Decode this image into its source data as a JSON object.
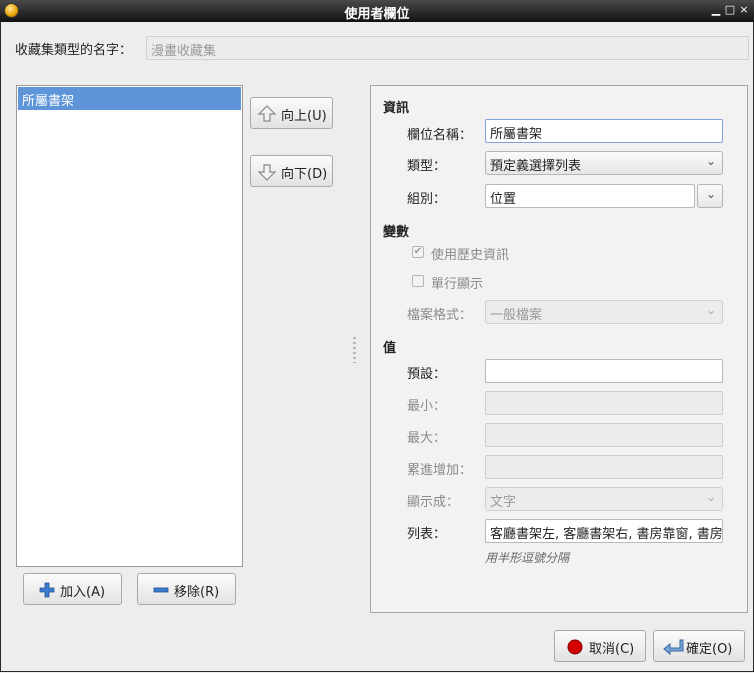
{
  "window": {
    "title": "使用者欄位",
    "min_glyph": "▁",
    "max_glyph": "□",
    "close_glyph": "×"
  },
  "header": {
    "label": "收藏集類型的名字：",
    "placeholder": "漫畫收藏集"
  },
  "fields_list": {
    "items": [
      "所屬書架"
    ]
  },
  "move_buttons": {
    "up": "向上(U)",
    "down": "向下(D)"
  },
  "list_buttons": {
    "add": "加入(A)",
    "remove": "移除(R)"
  },
  "info": {
    "heading": "資訊",
    "name_label": "欄位名稱：",
    "name_value": "所屬書架",
    "type_label": "類型：",
    "type_value": "預定義選擇列表",
    "group_label": "組別：",
    "group_value": "位置"
  },
  "variables": {
    "heading": "變數",
    "use_history_label": "使用歷史資訊",
    "use_history_checked": true,
    "single_line_label": "單行顯示",
    "single_line_checked": false,
    "file_format_label": "檔案格式：",
    "file_format_value": "一般檔案"
  },
  "values": {
    "heading": "值",
    "default_label": "預設：",
    "default_value": "",
    "min_label": "最小：",
    "max_label": "最大：",
    "increment_label": "累進增加：",
    "display_label": "顯示成：",
    "display_value": "文字",
    "list_label": "列表：",
    "list_value": "客廳書架左, 客廳書架右, 書房靠窗, 書房靠",
    "list_hint": "用半形逗號分隔"
  },
  "footer": {
    "cancel": "取消(C)",
    "ok": "確定(O)"
  },
  "colors": {
    "selection": "#5e94d8",
    "titlebar": "#1a1a1a"
  }
}
